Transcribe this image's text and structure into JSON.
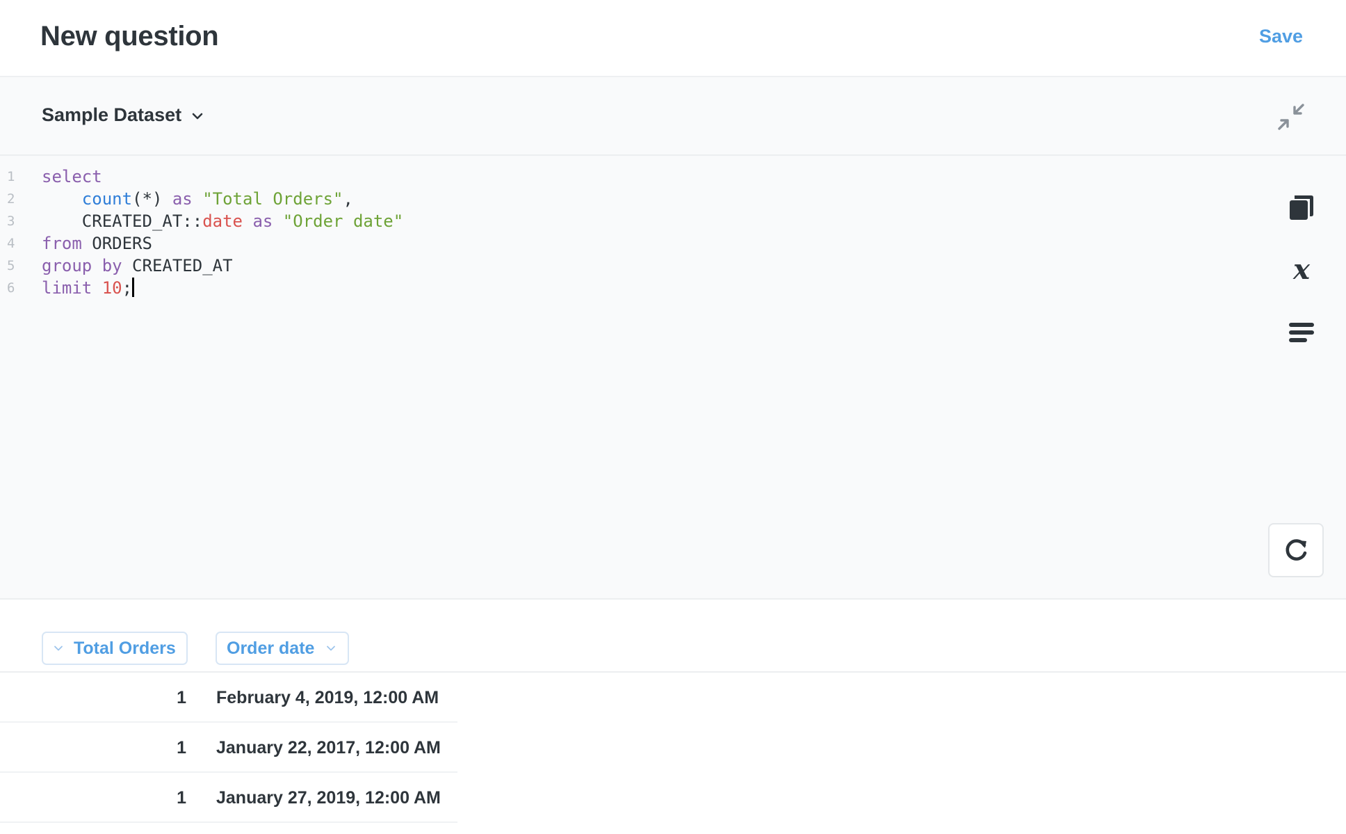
{
  "header": {
    "title": "New question",
    "save_label": "Save"
  },
  "toolbar": {
    "database": "Sample Dataset",
    "database_icon": "chevron-down-icon",
    "contract_icon": "contract-icon"
  },
  "editor": {
    "line_numbers": [
      "1",
      "2",
      "3",
      "4",
      "5",
      "6"
    ],
    "lines": [
      [
        {
          "t": "select",
          "c": "kw"
        }
      ],
      [
        {
          "t": "    ",
          "c": ""
        },
        {
          "t": "count",
          "c": "fn"
        },
        {
          "t": "(*) ",
          "c": ""
        },
        {
          "t": "as",
          "c": "kw"
        },
        {
          "t": " ",
          "c": ""
        },
        {
          "t": "\"Total Orders\"",
          "c": "str"
        },
        {
          "t": ",",
          "c": ""
        }
      ],
      [
        {
          "t": "    CREATED_AT::",
          "c": ""
        },
        {
          "t": "date",
          "c": "typ"
        },
        {
          "t": " ",
          "c": ""
        },
        {
          "t": "as",
          "c": "kw"
        },
        {
          "t": " ",
          "c": ""
        },
        {
          "t": "\"Order date\"",
          "c": "str"
        }
      ],
      [
        {
          "t": "from",
          "c": "kw"
        },
        {
          "t": " ORDERS",
          "c": ""
        }
      ],
      [
        {
          "t": "group by",
          "c": "kw"
        },
        {
          "t": " CREATED_AT",
          "c": ""
        }
      ],
      [
        {
          "t": "limit",
          "c": "kw"
        },
        {
          "t": " ",
          "c": ""
        },
        {
          "t": "10",
          "c": "num"
        },
        {
          "t": ";",
          "c": ""
        }
      ]
    ],
    "side_tools": [
      "data-reference-icon",
      "variables-icon",
      "snippets-icon"
    ],
    "run_icon": "refresh-icon"
  },
  "results": {
    "columns": [
      "Total Orders",
      "Order date"
    ],
    "rows": [
      [
        "1",
        "February 4, 2019, 12:00 AM"
      ],
      [
        "1",
        "January 22, 2017, 12:00 AM"
      ],
      [
        "1",
        "January 27, 2019, 12:00 AM"
      ]
    ]
  },
  "colors": {
    "accent": "#509ee3",
    "keyword": "#8a5fad",
    "function": "#2f7ed8",
    "string": "#6ea337",
    "number": "#d9534f"
  }
}
